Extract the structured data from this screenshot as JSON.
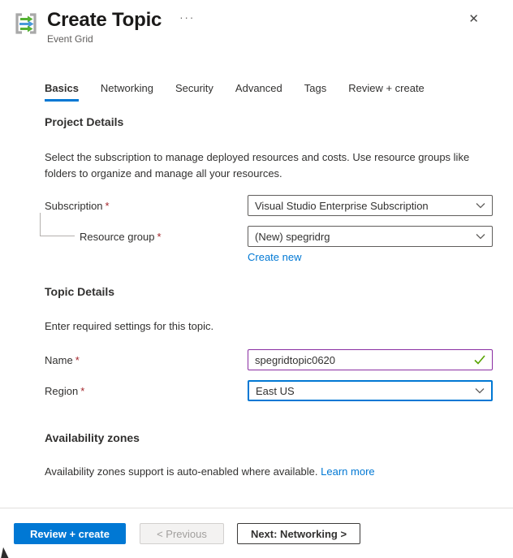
{
  "header": {
    "title": "Create Topic",
    "subtitle": "Event Grid",
    "more_options": "···",
    "close": "✕"
  },
  "tabs": [
    {
      "label": "Basics"
    },
    {
      "label": "Networking"
    },
    {
      "label": "Security"
    },
    {
      "label": "Advanced"
    },
    {
      "label": "Tags"
    },
    {
      "label": "Review + create"
    }
  ],
  "project": {
    "heading": "Project Details",
    "description": "Select the subscription to manage deployed resources and costs. Use resource groups like folders to organize and manage all your resources.",
    "subscription": {
      "label": "Subscription",
      "required": "*",
      "value": "Visual Studio Enterprise Subscription"
    },
    "resource_group": {
      "label": "Resource group",
      "required": "*",
      "value": "(New) spegridrg",
      "create_new": "Create new"
    }
  },
  "topic": {
    "heading": "Topic Details",
    "description": "Enter required settings for this topic.",
    "name": {
      "label": "Name",
      "required": "*",
      "value": "spegridtopic0620"
    },
    "region": {
      "label": "Region",
      "required": "*",
      "value": "East US"
    }
  },
  "availability": {
    "heading": "Availability zones",
    "text": "Availability zones support is auto-enabled where available.",
    "learn_more": "Learn more"
  },
  "footer": {
    "review_create": "Review + create",
    "previous": "< Previous",
    "next": "Next: Networking >"
  },
  "colors": {
    "accent": "#0078d4",
    "required": "#a4262c",
    "valid_field_border": "#8a2da2",
    "success_check": "#57a300",
    "link": "#0078d4"
  }
}
